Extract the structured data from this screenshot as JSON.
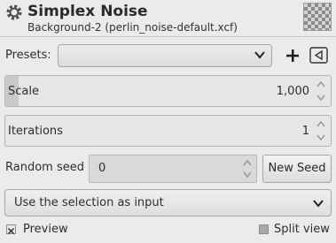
{
  "header": {
    "title": "Simplex Noise",
    "subtitle": "Background-2 (perlin_noise-default.xcf)",
    "icon": "gegl-gear-icon",
    "thumbnail": "layer-thumbnail-transparent"
  },
  "presets": {
    "label": "Presets:",
    "selected": "",
    "add_icon": "plus-icon",
    "menu_icon": "menu-triangle-icon"
  },
  "scale": {
    "label": "Scale",
    "value": "1,000",
    "fill_fraction": 0.04
  },
  "iterations": {
    "label": "Iterations",
    "value": "1",
    "fill_fraction": 0.0
  },
  "seed": {
    "label": "Random seed",
    "value": "0",
    "new_seed_label": "New Seed"
  },
  "selection_input": {
    "value": "Use the selection as input"
  },
  "footer": {
    "preview_label": "Preview",
    "preview_checked": true,
    "split_view_label": "Split view",
    "split_view_checked": false
  }
}
